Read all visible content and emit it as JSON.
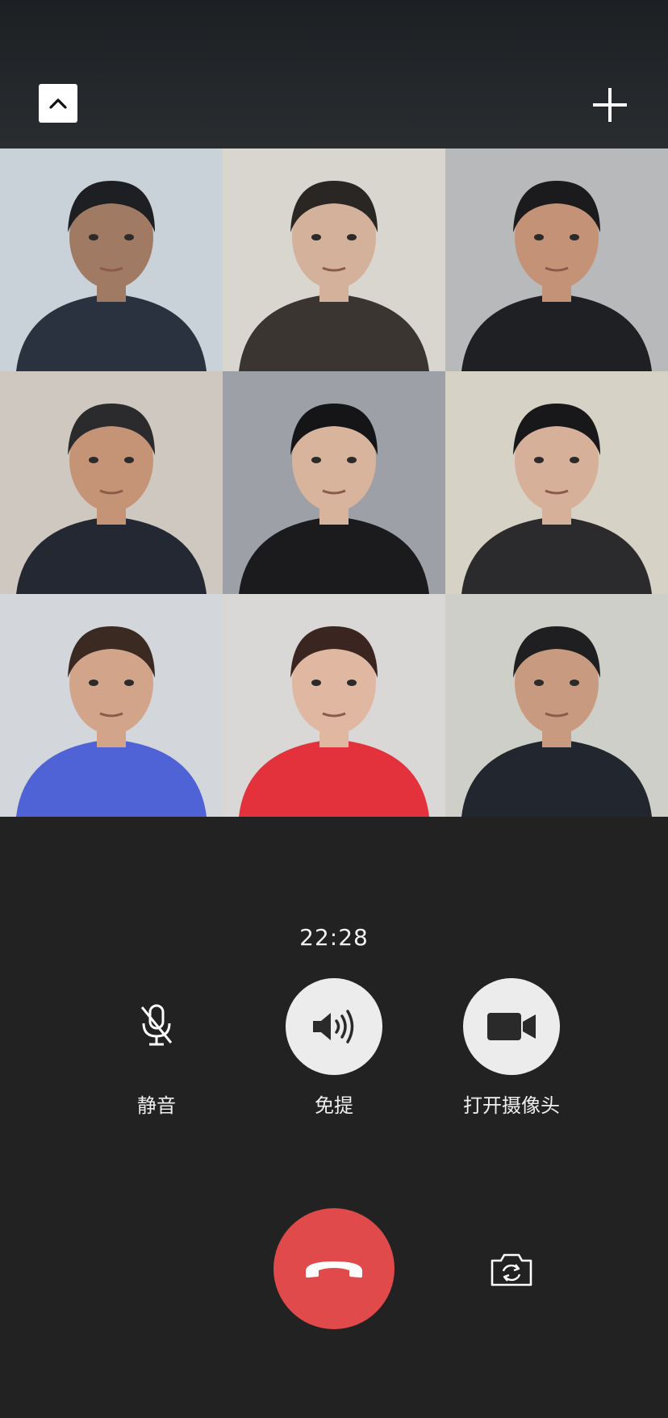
{
  "toolbar": {
    "collapse_icon": "chevron-up-icon",
    "add_icon": "plus-icon"
  },
  "participants": [
    {
      "bg": "#c9d2d8",
      "skin": "#a07a62",
      "hair": "#1e1f22",
      "clothes": "#2a3240"
    },
    {
      "bg": "#d9d6d0",
      "skin": "#d4b19a",
      "hair": "#2a2624",
      "clothes": "#3a3530"
    },
    {
      "bg": "#b8b9bb",
      "skin": "#c49377",
      "hair": "#1b1b1d",
      "clothes": "#1e2024"
    },
    {
      "bg": "#cfc8c0",
      "skin": "#c59477",
      "hair": "#2b2b2d",
      "clothes": "#232833"
    },
    {
      "bg": "#9da0a6",
      "skin": "#d8b49c",
      "hair": "#151517",
      "clothes": "#1b1b1e"
    },
    {
      "bg": "#d7d2c6",
      "skin": "#d7b09a",
      "hair": "#18181b",
      "clothes": "#2b2b2e"
    },
    {
      "bg": "#d3d6da",
      "skin": "#d2a58a",
      "hair": "#3a2a22",
      "clothes": "#4f63d6"
    },
    {
      "bg": "#d9d8d6",
      "skin": "#e0b8a2",
      "hair": "#3b2520",
      "clothes": "#e3323c"
    },
    {
      "bg": "#cfcfca",
      "skin": "#c89a80",
      "hair": "#1f1f21",
      "clothes": "#22262e"
    }
  ],
  "call": {
    "duration": "22:28"
  },
  "controls": {
    "mute_label": "静音",
    "speaker_label": "免提",
    "camera_label": "打开摄像头",
    "mute_icon": "microphone-off-icon",
    "speaker_icon": "speaker-icon",
    "camera_icon": "video-camera-icon",
    "hangup_icon": "phone-hangup-icon",
    "flip_icon": "camera-flip-icon"
  },
  "colors": {
    "background": "#222222",
    "hangup": "#e14a4a",
    "button_light": "#ececec"
  }
}
